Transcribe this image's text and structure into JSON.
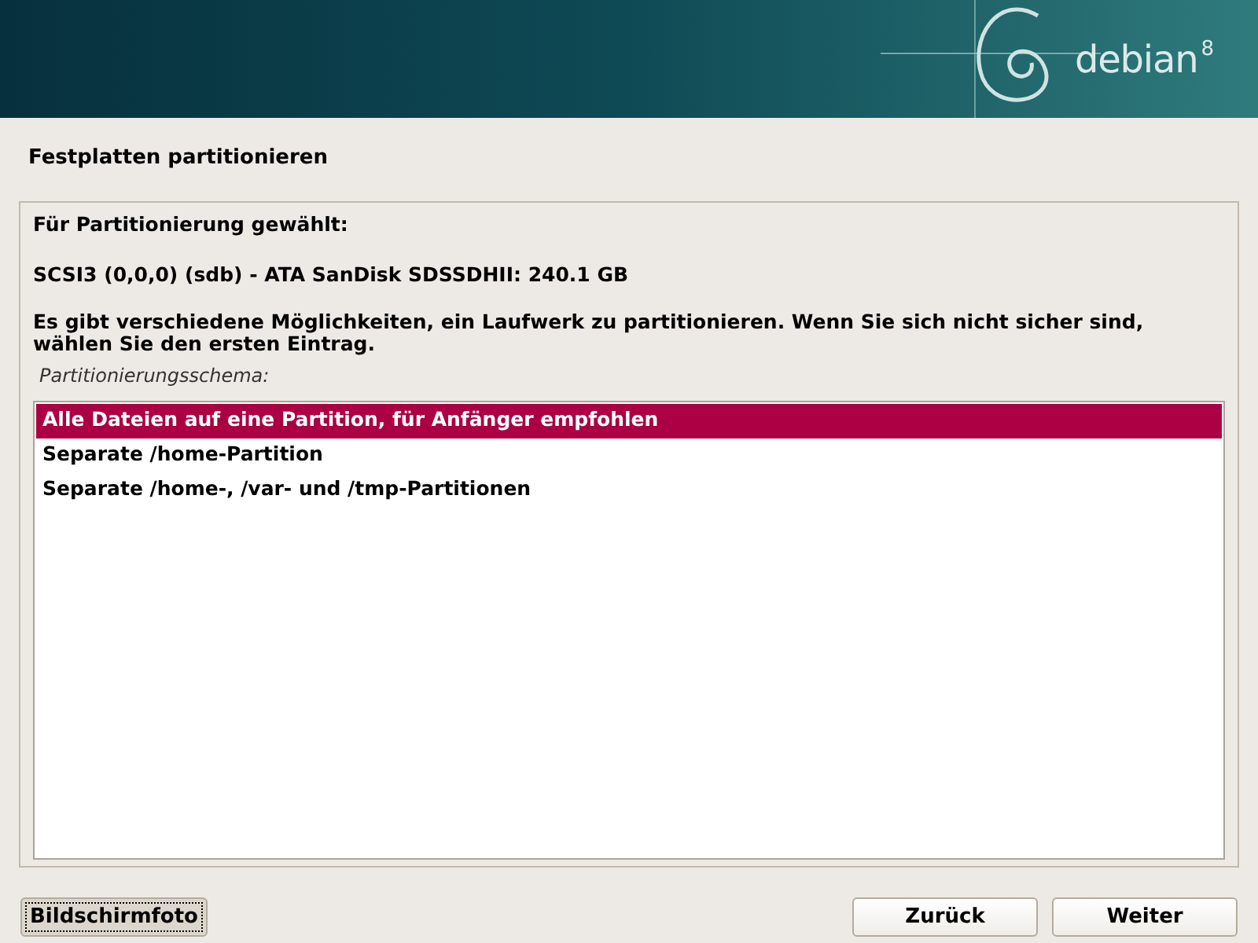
{
  "header": {
    "logo": "debian",
    "version": "8"
  },
  "title": "Festplatten partitionieren",
  "panel": {
    "heading": "Für Partitionierung gewählt:",
    "disk": "SCSI3 (0,0,0) (sdb) - ATA SanDisk SDSSDHII: 240.1 GB",
    "description": "Es gibt verschiedene Möglichkeiten, ein Laufwerk zu partitionieren. Wenn Sie sich nicht sicher sind, wählen Sie den ersten Eintrag.",
    "list_label": "Partitionierungsschema:"
  },
  "options": [
    {
      "label": "Alle Dateien auf eine Partition, für Anfänger empfohlen",
      "selected": true
    },
    {
      "label": "Separate /home-Partition",
      "selected": false
    },
    {
      "label": "Separate /home-, /var- und /tmp-Partitionen",
      "selected": false
    }
  ],
  "buttons": [
    {
      "label": "Bildschirmfoto",
      "focused": true
    },
    {
      "label": "Zurück",
      "focused": false
    },
    {
      "label": "Weiter",
      "focused": false
    }
  ]
}
